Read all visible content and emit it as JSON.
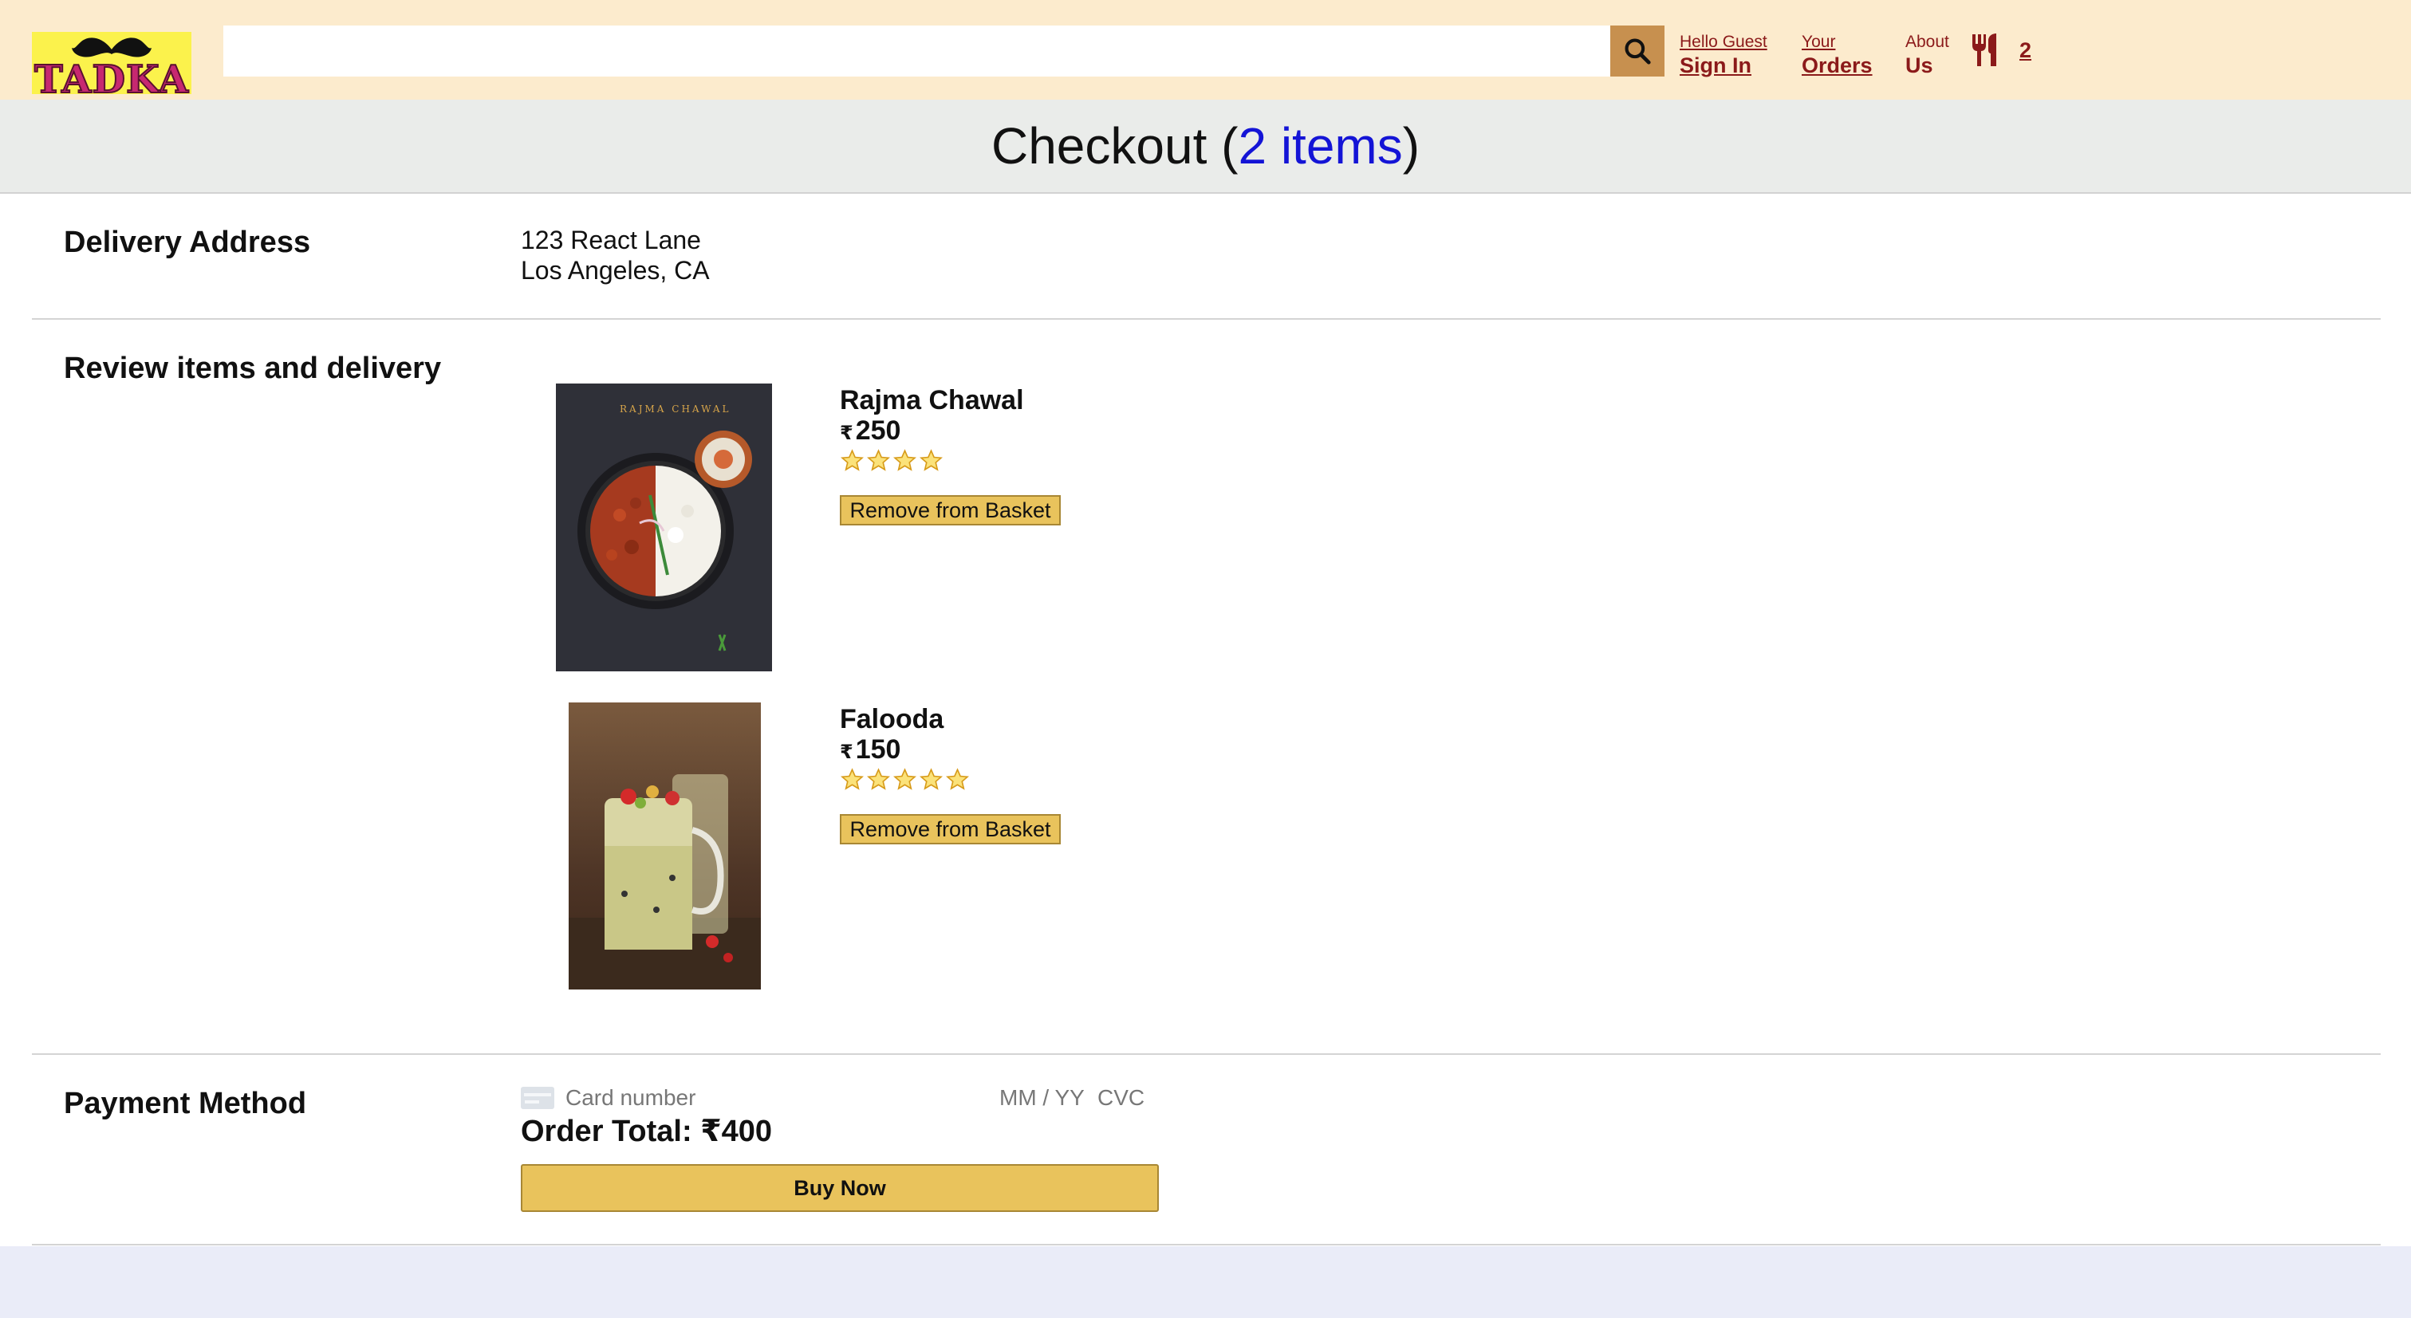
{
  "header": {
    "logo_text": "TADKA",
    "search": {
      "value": "",
      "placeholder": ""
    },
    "nav": [
      {
        "line1": "Hello Guest",
        "line2": "Sign In"
      },
      {
        "line1": "Your",
        "line2": "Orders"
      },
      {
        "line1": "About",
        "line2": "Us"
      }
    ],
    "basket": {
      "icon": "fork-knife-icon",
      "count": "2"
    },
    "colors": {
      "background": "#fcebcd",
      "logo_bg": "#fbf24c",
      "link": "#8b1a1a",
      "search_button": "#c7904f"
    }
  },
  "checkout": {
    "title_prefix": "Checkout (",
    "item_count_text": "2 items",
    "title_suffix": ")"
  },
  "delivery": {
    "title": "Delivery Address",
    "lines": [
      "123 React Lane",
      "Los Angeles, CA"
    ]
  },
  "review": {
    "title": "Review items and delivery",
    "items": [
      {
        "name": "Rajma Chawal",
        "currency": "₹",
        "price": "250",
        "rating": 4,
        "remove_label": "Remove from Basket",
        "image": "rajma-chawal-photo",
        "image_caption": "RAJMA CHAWAL"
      },
      {
        "name": "Falooda",
        "currency": "₹",
        "price": "150",
        "rating": 5,
        "remove_label": "Remove from Basket",
        "image": "falooda-photo"
      }
    ]
  },
  "payment": {
    "title": "Payment Method",
    "card_placeholder": "Card number",
    "expiry_placeholder": "MM / YY",
    "cvc_placeholder": "CVC",
    "order_total": "Order Total: ₹400",
    "buy_label": "Buy Now",
    "colors": {
      "button": "#e9c35c",
      "button_border": "#a88734"
    }
  },
  "colors": {
    "title_count": "#1414d6",
    "page_bottom": "#eaecf8"
  }
}
